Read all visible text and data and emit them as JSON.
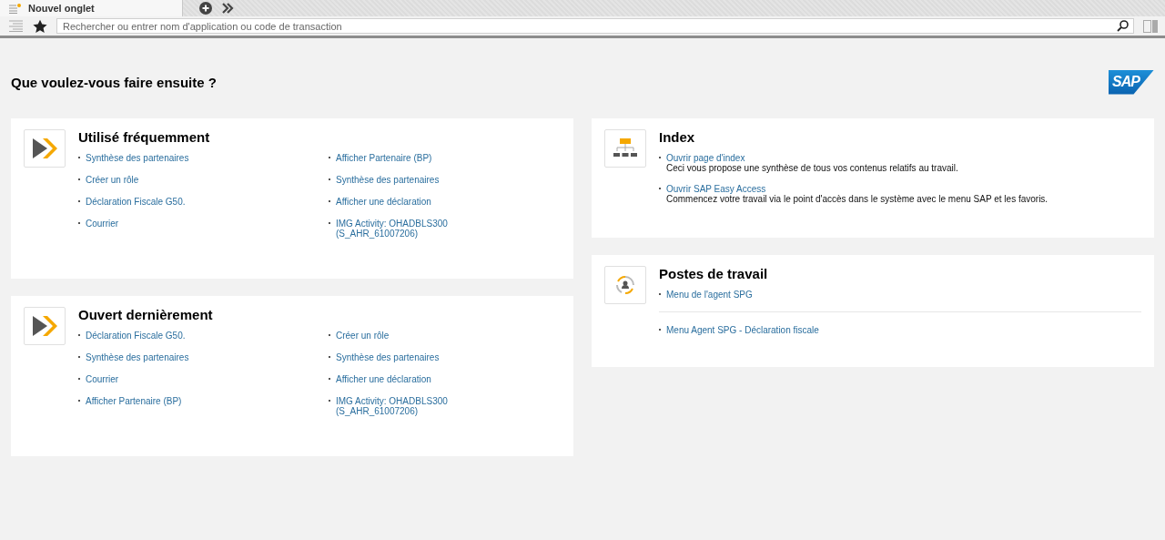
{
  "tabs": [
    {
      "label": "Nouvel onglet",
      "selected": true
    }
  ],
  "toolbar": {
    "search": {
      "placeholder": "Rechercher ou entrer nom d'application ou code de transaction"
    }
  },
  "heading": "Que voulez-vous faire ensuite ?",
  "logo": "SAP",
  "left_panels": [
    {
      "title": "Utilisé fréquemment",
      "columns": [
        [
          "Synthèse des partenaires",
          "Créer un rôle",
          "Déclaration Fiscale G50.",
          "Courrier"
        ],
        [
          "Afficher Partenaire (BP)",
          "Synthèse des partenaires",
          "Afficher une déclaration",
          "IMG Activity: OHADBLS300\n(S_AHR_61007206)"
        ]
      ]
    },
    {
      "title": "Ouvert dernièrement",
      "columns": [
        [
          "Déclaration Fiscale G50.",
          "Synthèse des partenaires",
          "Courrier",
          "Afficher Partenaire (BP)"
        ],
        [
          "Créer un rôle",
          "Synthèse des partenaires",
          "Afficher une déclaration",
          "IMG Activity: OHADBLS300\n(S_AHR_61007206)"
        ]
      ]
    }
  ],
  "index": {
    "title": "Index",
    "items": [
      {
        "link": "Ouvrir page d'index",
        "description": "Ceci vous propose une synthèse de tous vos contenus relatifs au travail."
      },
      {
        "link": "Ouvrir SAP Easy Access",
        "description": "Commencez votre travail via le point d'accès dans le système avec le menu SAP et les favoris."
      }
    ]
  },
  "workplaces": {
    "title": "Postes de travail",
    "items": [
      "Menu de l'agent SPG",
      "Menu Agent SPG - Déclaration fiscale"
    ]
  }
}
